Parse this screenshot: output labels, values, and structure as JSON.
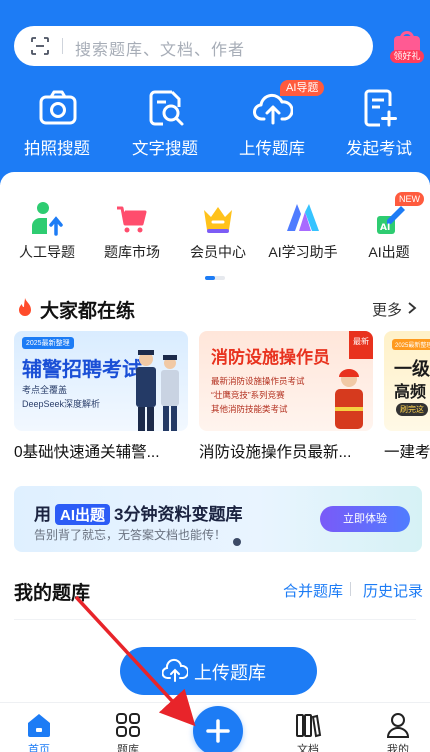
{
  "search": {
    "placeholder": "搜索题库、文档、作者"
  },
  "gift": {
    "label": "领好礼"
  },
  "quick_actions": [
    {
      "label": "拍照搜题",
      "icon": "camera-icon"
    },
    {
      "label": "文字搜题",
      "icon": "doc-search-icon"
    },
    {
      "label": "上传题库",
      "icon": "cloud-upload-icon",
      "badge": "AI导题"
    },
    {
      "label": "发起考试",
      "icon": "exam-plus-icon"
    }
  ],
  "categories": [
    {
      "label": "人工导题",
      "icon": "person-import-icon"
    },
    {
      "label": "题库市场",
      "icon": "cart-icon"
    },
    {
      "label": "会员中心",
      "icon": "crown-icon"
    },
    {
      "label": "AI学习助手",
      "icon": "ai-assistant-icon"
    },
    {
      "label": "AI出题",
      "icon": "ai-pen-icon",
      "badge": "NEW"
    }
  ],
  "section_popular": {
    "title": "大家都在练",
    "more": "更多"
  },
  "banners": [
    {
      "title": "0基础快速通关辅警...",
      "tag": "2025最新整理",
      "headline": "辅警招聘考试",
      "bullets": [
        "考点全覆盖",
        "DeepSeek深度解析"
      ]
    },
    {
      "title": "消防设施操作员最新...",
      "headline": "消防设施操作员",
      "corner": "最新",
      "bullets": [
        "最新消防设施操作员考试",
        "“壮鹰竞技”系列竞赛",
        "其他消防技能类考试"
      ]
    },
    {
      "title": "一建考",
      "tag": "2025最新整理",
      "headline": "一级",
      "sub": "高频",
      "button": "刷完这"
    }
  ],
  "ai_banner": {
    "prefix": "用",
    "pill": "AI出题",
    "suffix": "3分钟资料变题库",
    "subtitle": "告别背了就忘，无答案文档也能传！",
    "cta": "立即体验"
  },
  "my_bank": {
    "title": "我的题库",
    "merge": "合并题库",
    "history": "历史记录"
  },
  "upload_button": {
    "label": "上传题库"
  },
  "bottom_nav": [
    {
      "label": "首页",
      "icon": "home-icon",
      "active": true
    },
    {
      "label": "题库",
      "icon": "grid-icon"
    },
    {
      "label": "文档",
      "icon": "books-icon"
    },
    {
      "label": "我的",
      "icon": "profile-icon"
    }
  ],
  "colors": {
    "primary": "#1d7cf5",
    "accent_red": "#ff5b3e",
    "annotation_arrow": "#e8242a"
  }
}
